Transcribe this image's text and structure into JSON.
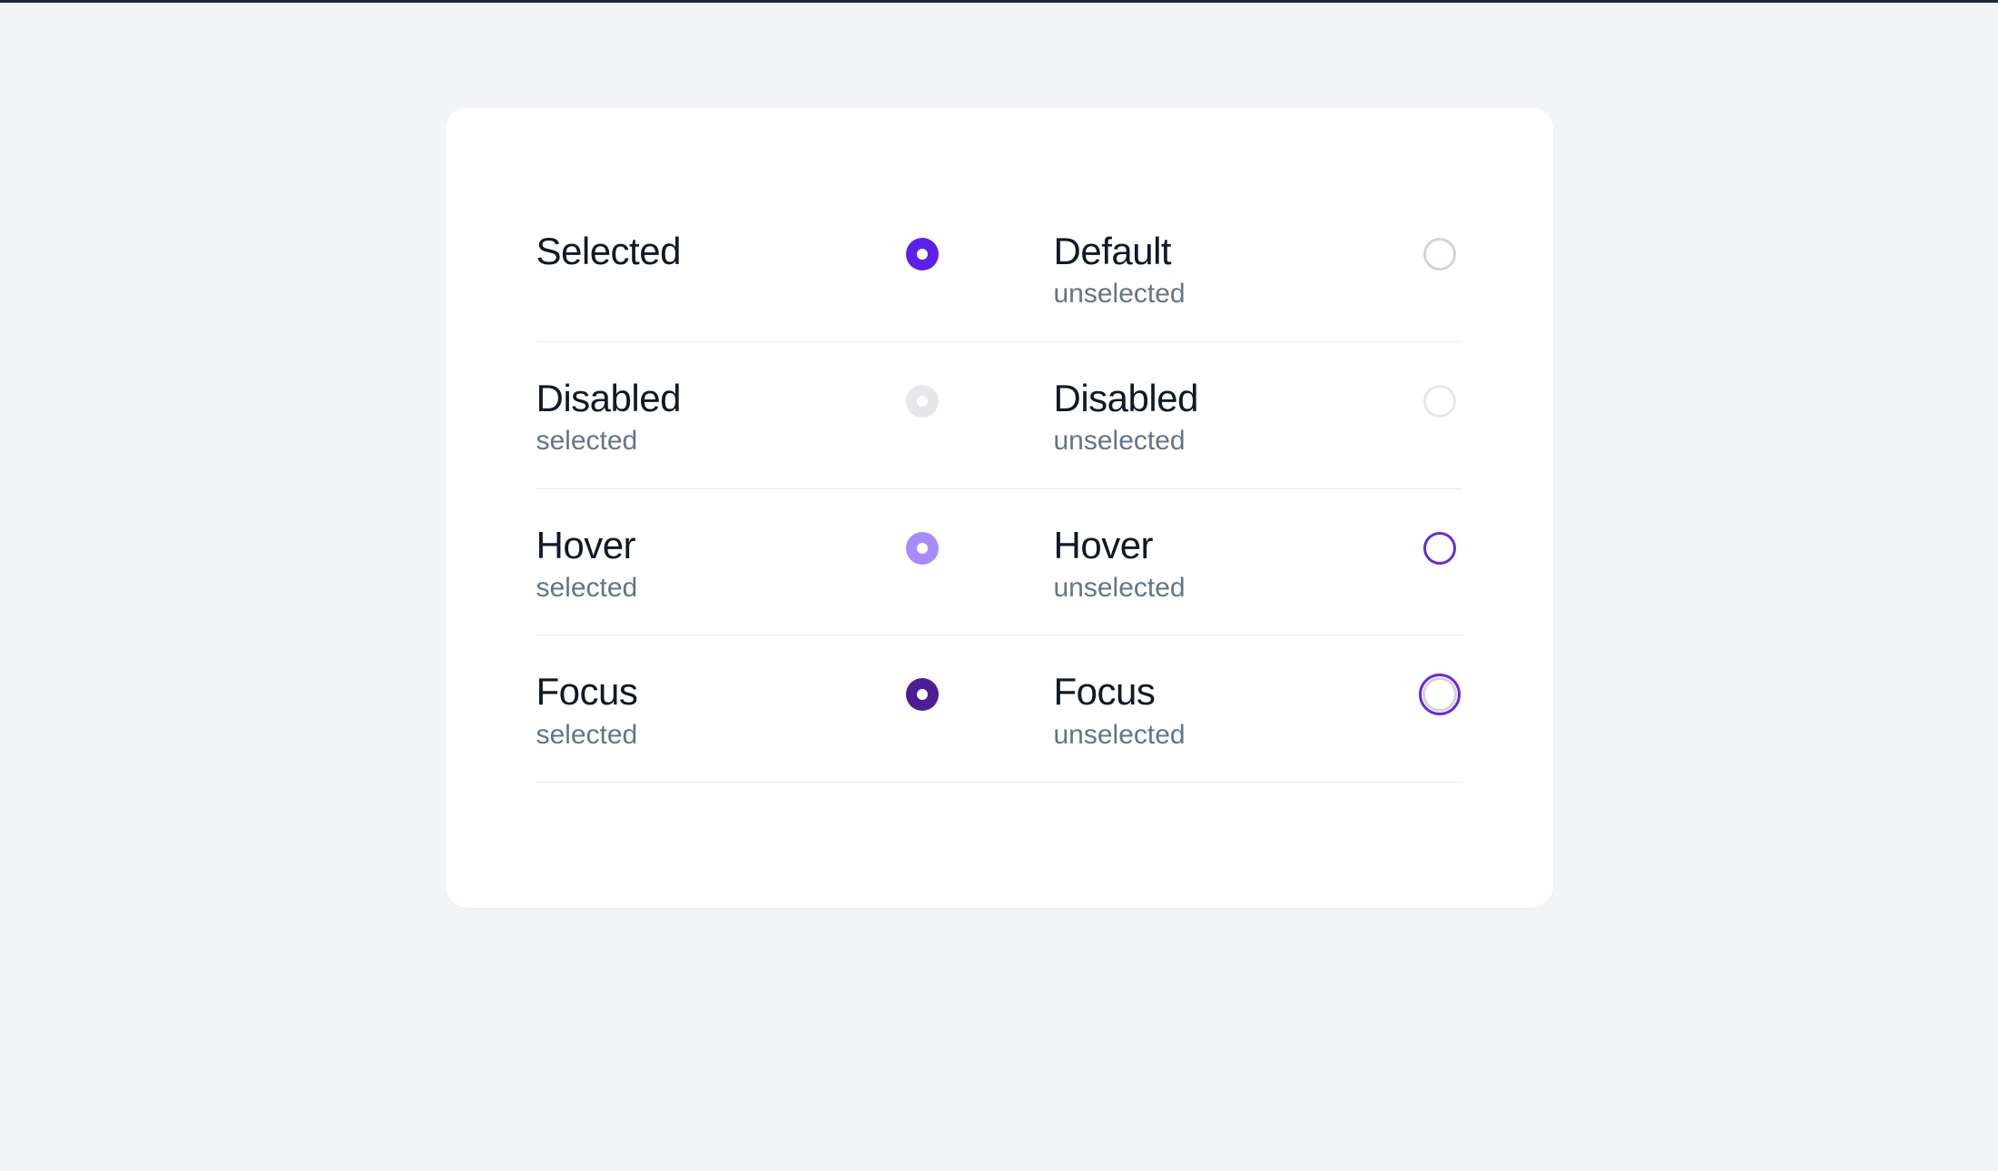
{
  "rows": [
    {
      "left": {
        "title": "Selected",
        "subtitle": "",
        "variant": "selected"
      },
      "right": {
        "title": "Default",
        "subtitle": "unselected",
        "variant": "unselected"
      }
    },
    {
      "left": {
        "title": "Disabled",
        "subtitle": "selected",
        "variant": "disabled-selected"
      },
      "right": {
        "title": "Disabled",
        "subtitle": "unselected",
        "variant": "disabled-unselected"
      }
    },
    {
      "left": {
        "title": "Hover",
        "subtitle": "selected",
        "variant": "hover-selected"
      },
      "right": {
        "title": "Hover",
        "subtitle": "unselected",
        "variant": "hover-unselected"
      }
    },
    {
      "left": {
        "title": "Focus",
        "subtitle": "selected",
        "variant": "focus-selected"
      },
      "right": {
        "title": "Focus",
        "subtitle": "unselected",
        "variant": "focus-unselected"
      }
    }
  ],
  "colors": {
    "accent": "#5b21e6",
    "accent_hover": "#a78bfa",
    "accent_focus": "#4c1d95",
    "ring": "#6d28d9",
    "border_default": "#d1d5db",
    "border_disabled": "#e5e7eb",
    "text_secondary": "#64748b"
  }
}
